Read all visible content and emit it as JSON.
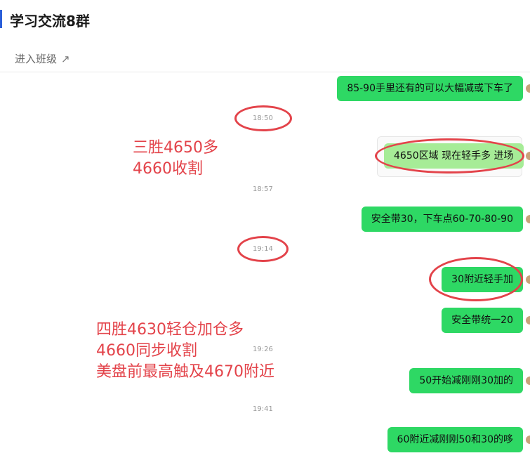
{
  "header": {
    "title": "学习交流8群",
    "enter_label": "进入班级",
    "enter_arrow": "↗"
  },
  "messages": [
    "85-90手里还有的可以大幅减或下车了",
    "4650区域 现在轻手多 进场",
    "安全带30，下车点60-70-80-90",
    "30附近轻手加",
    "安全带统一20",
    "50开始减刚刚30加的",
    "60附近减刚刚50和30的哆"
  ],
  "timestamps": [
    "18:50",
    "18:57",
    "19:14",
    "19:26",
    "19:41"
  ],
  "annotations": {
    "first": [
      "三胜4650多",
      "4660收割"
    ],
    "second": [
      "四胜4630轻仓加仓多",
      "4660同步收割",
      "美盘前最高触及4670附近"
    ]
  },
  "colors": {
    "bubble": "#2ed864",
    "bubble_highlight": "#a6ec97",
    "annotation": "#e3434a",
    "accent": "#2b5fd9"
  }
}
